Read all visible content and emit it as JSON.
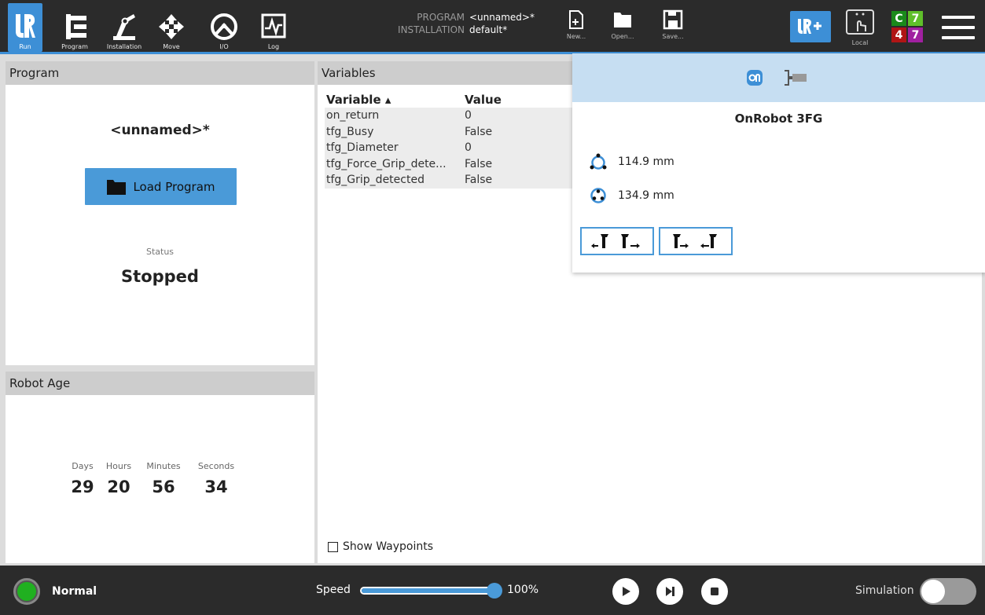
{
  "header": {
    "tabs": [
      {
        "id": "run",
        "label": "Run",
        "active": true
      },
      {
        "id": "program",
        "label": "Program"
      },
      {
        "id": "installation",
        "label": "Installation"
      },
      {
        "id": "move",
        "label": "Move"
      },
      {
        "id": "io",
        "label": "I/O"
      },
      {
        "id": "log",
        "label": "Log"
      }
    ],
    "program_key": "PROGRAM",
    "program_value": "<unnamed>*",
    "installation_key": "INSTALLATION",
    "installation_value": "default*",
    "file_buttons": {
      "new": "New...",
      "open": "Open...",
      "save": "Save..."
    },
    "local_label": "Local",
    "status_grid": [
      {
        "text": "C",
        "color": "#1a8a1a"
      },
      {
        "text": "7",
        "color": "#5fbf2a"
      },
      {
        "text": "4",
        "color": "#b01515"
      },
      {
        "text": "7",
        "color": "#a020a0"
      }
    ],
    "accent_color": "#3d8fd6"
  },
  "program_panel": {
    "title": "Program",
    "program_name": "<unnamed>*",
    "load_button": "Load Program",
    "status_label": "Status",
    "status_value": "Stopped"
  },
  "robot_age": {
    "title": "Robot Age",
    "units": [
      {
        "label": "Days",
        "value": "29"
      },
      {
        "label": "Hours",
        "value": "20"
      },
      {
        "label": "Minutes",
        "value": "56"
      },
      {
        "label": "Seconds",
        "value": "34"
      }
    ]
  },
  "variables_panel": {
    "title": "Variables",
    "columns": [
      "Variable ▴",
      "Value"
    ],
    "rows": [
      {
        "name": "on_return",
        "value": "0"
      },
      {
        "name": "tfg_Busy",
        "value": "False"
      },
      {
        "name": "tfg_Diameter",
        "value": "0"
      },
      {
        "name": "tfg_Force_Grip_dete...",
        "value": "False"
      },
      {
        "name": "tfg_Grip_detected",
        "value": "False"
      }
    ],
    "show_waypoints": "Show Waypoints"
  },
  "onrobot": {
    "title": "OnRobot 3FG",
    "external_diameter": "114.9 mm",
    "internal_diameter": "134.9 mm",
    "icons": [
      "onrobot-logo-icon",
      "gripper-icon",
      "external-grip-icon",
      "internal-grip-icon"
    ]
  },
  "footer": {
    "mode": "Normal",
    "speed_label": "Speed",
    "speed_value": "100%",
    "speed_fraction": 1.0,
    "simulation_label": "Simulation"
  }
}
